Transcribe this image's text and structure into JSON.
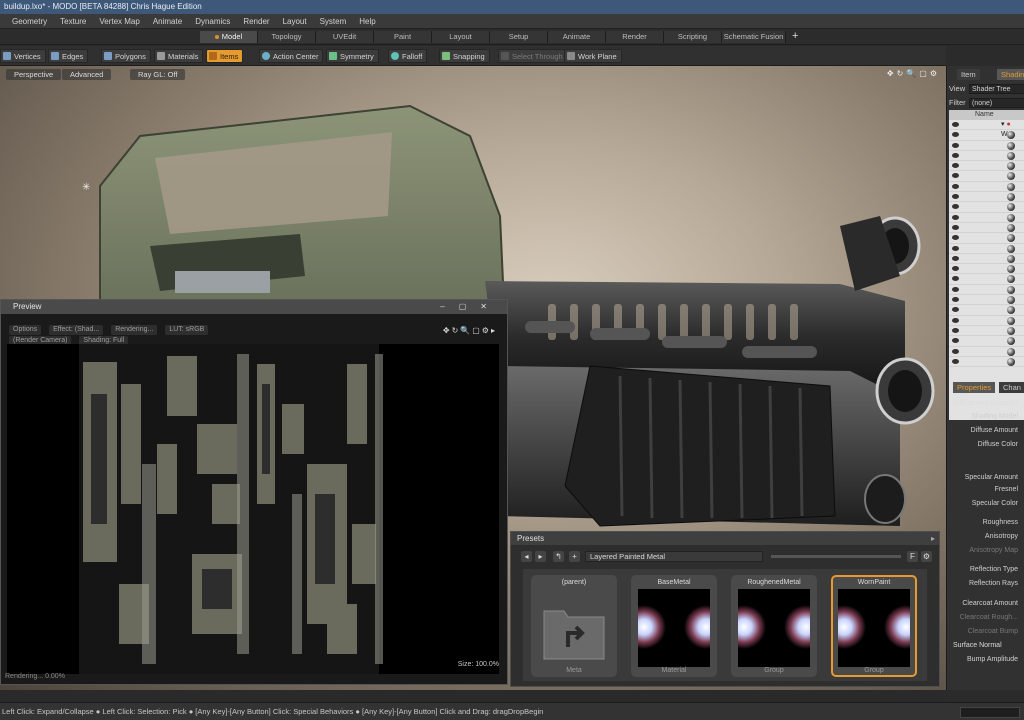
{
  "window": {
    "title": "buildup.lxo* - MODO [BETA 84288] Chris Hague Edition"
  },
  "menu": [
    "Geometry",
    "Texture",
    "Vertex Map",
    "Animate",
    "Dynamics",
    "Render",
    "Layout",
    "System",
    "Help"
  ],
  "layout_tabs": [
    {
      "label": "Model",
      "active": true
    },
    {
      "label": "Topology"
    },
    {
      "label": "UVEdit"
    },
    {
      "label": "Paint"
    },
    {
      "label": "Layout"
    },
    {
      "label": "Setup"
    },
    {
      "label": "Animate"
    },
    {
      "label": "Render"
    },
    {
      "label": "Scripting"
    },
    {
      "label": "Schematic Fusion"
    }
  ],
  "toolbar": {
    "vertices": "Vertices",
    "edges": "Edges",
    "polygons": "Polygons",
    "materials": "Materials",
    "items": "Items",
    "action_center": "Action Center",
    "symmetry": "Symmetry",
    "falloff": "Falloff",
    "snapping": "Snapping",
    "select_through": "Select Through",
    "work_plane": "Work Plane"
  },
  "viewport": {
    "view": "Perspective",
    "style": "Advanced",
    "ray_gl": "Ray GL: Off"
  },
  "preview": {
    "title": "Preview",
    "options": "Options",
    "effect": "Effect: (Shad...",
    "rendering": "Rendering...",
    "lut": "LUT: sRGB",
    "camera": "(Render Camera)",
    "shading": "Shading: Full",
    "status": "Rendering... 0.00%",
    "size": "Size: 100.0%"
  },
  "presets": {
    "title": "Presets",
    "path": "Layered Painted Metal",
    "items": [
      {
        "name": "(parent)",
        "type": "Meta",
        "kind": "folder"
      },
      {
        "name": "BaseMetal",
        "type": "Material",
        "kind": "ball"
      },
      {
        "name": "RoughenedMetal",
        "type": "Group",
        "kind": "ball"
      },
      {
        "name": "WornPaint",
        "type": "Group",
        "kind": "ball",
        "selected": true
      }
    ]
  },
  "right_panel": {
    "tabs": [
      "Item",
      "Shading"
    ],
    "view_label": "View",
    "view_value": "Shader Tree",
    "filter_label": "Filter",
    "filter_value": "(none)",
    "tree_header": "Name",
    "tree_first": "Wor",
    "prop_tabs": [
      "Properties",
      "Chan"
    ],
    "section_diffuse": "Diffuse and Specular",
    "props": [
      "Shading Model",
      "Diffuse Amount",
      "Diffuse Color",
      "Specular Amount",
      "Fresnel",
      "Specular Color",
      "Roughness",
      "Anisotropy",
      "Anisotropy Map",
      "Reflection Type",
      "Reflection Rays",
      "Clearcoat Amount",
      "Clearcoat Rough...",
      "Clearcoat Bump"
    ],
    "section_surface": "Surface Normal",
    "bump": "Bump Amplitude"
  },
  "status_bar": "Left Click: Expand/Collapse ● Left Click: Selection: Pick ● [Any Key]-[Any Button] Click: Special Behaviors ● [Any Key]-[Any Button] Click and Drag: dragDropBegin",
  "colors": {
    "accent": "#e59b2d",
    "titlebar": "#3d5878"
  }
}
